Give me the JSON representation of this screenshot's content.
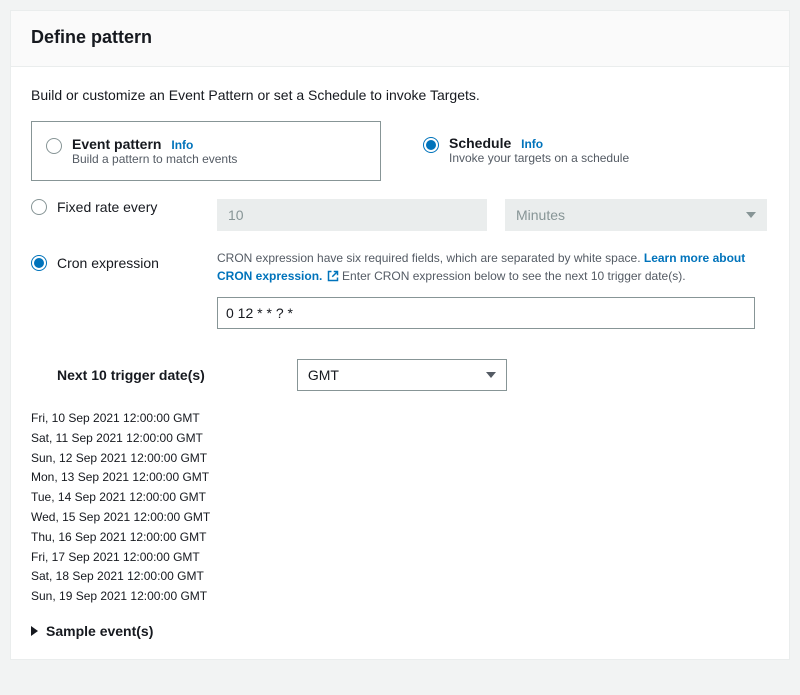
{
  "header": {
    "title": "Define pattern"
  },
  "description": "Build or customize an Event Pattern or set a Schedule to invoke Targets.",
  "patternOptions": {
    "eventPattern": {
      "title": "Event pattern",
      "info": "Info",
      "desc": "Build a pattern to match events",
      "selected": false
    },
    "schedule": {
      "title": "Schedule",
      "info": "Info",
      "desc": "Invoke your targets on a schedule",
      "selected": true
    }
  },
  "schedule": {
    "fixed": {
      "label": "Fixed rate every",
      "value": "10",
      "unit": "Minutes",
      "selected": false
    },
    "cron": {
      "label": "Cron expression",
      "help1": "CRON expression have six required fields, which are separated by white space. ",
      "helpLink": "Learn more about CRON expression.",
      "help2": " Enter CRON expression below to see the next 10 trigger date(s).",
      "value": "0 12 * * ? *",
      "selected": true
    }
  },
  "trigger": {
    "label": "Next 10 trigger date(s)",
    "tz": "GMT",
    "dates": [
      "Fri, 10 Sep 2021 12:00:00 GMT",
      "Sat, 11 Sep 2021 12:00:00 GMT",
      "Sun, 12 Sep 2021 12:00:00 GMT",
      "Mon, 13 Sep 2021 12:00:00 GMT",
      "Tue, 14 Sep 2021 12:00:00 GMT",
      "Wed, 15 Sep 2021 12:00:00 GMT",
      "Thu, 16 Sep 2021 12:00:00 GMT",
      "Fri, 17 Sep 2021 12:00:00 GMT",
      "Sat, 18 Sep 2021 12:00:00 GMT",
      "Sun, 19 Sep 2021 12:00:00 GMT"
    ]
  },
  "sample": "Sample event(s)"
}
